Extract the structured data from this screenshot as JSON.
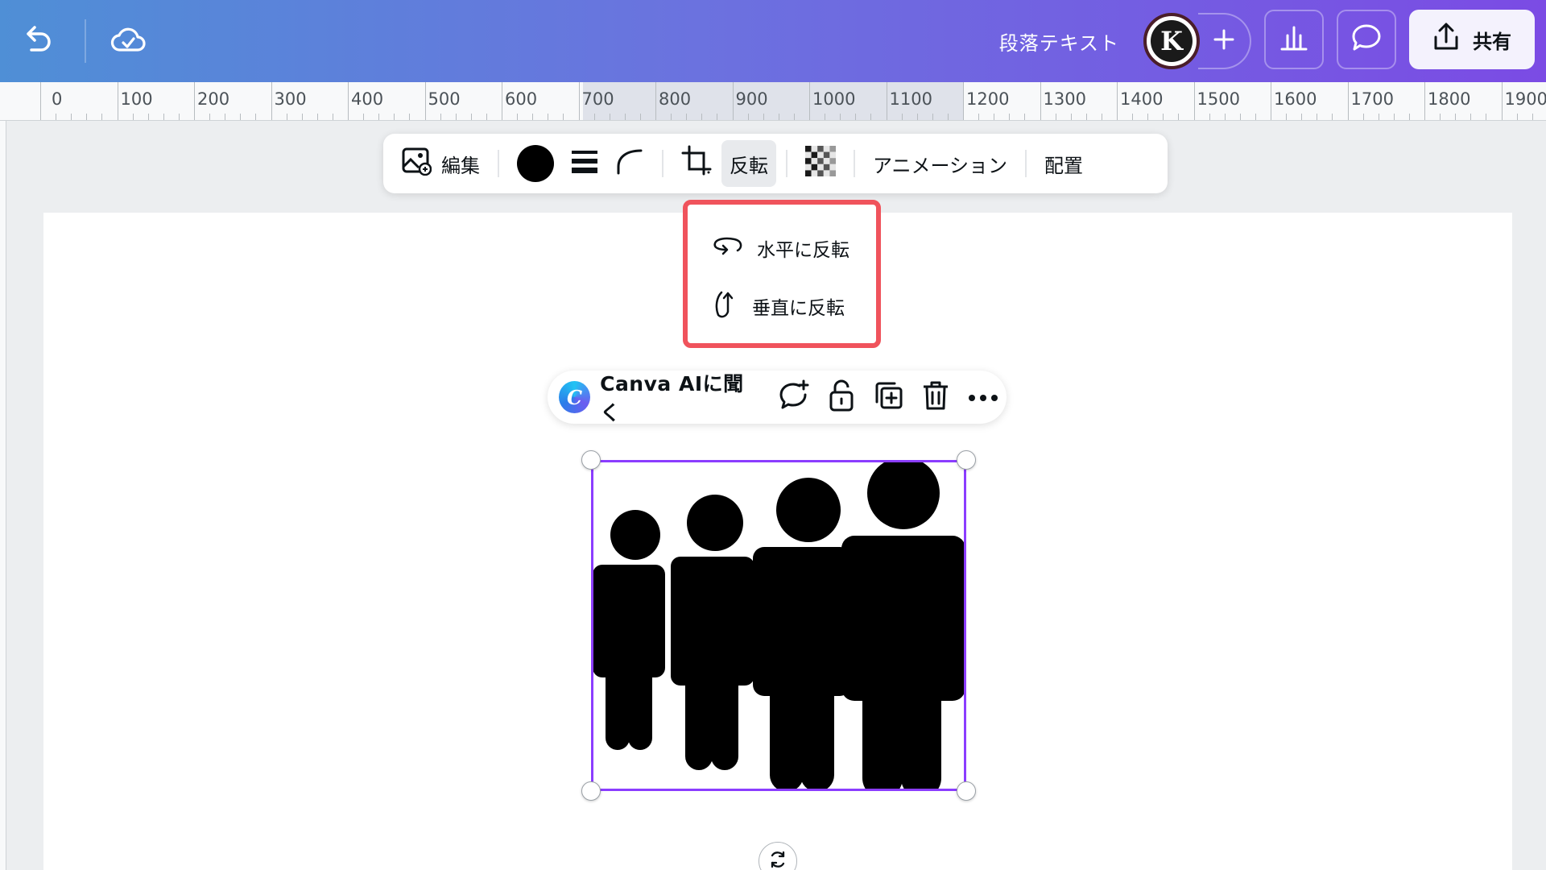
{
  "header": {
    "doc_title": "段落テキスト",
    "avatar_letter": "K",
    "share_label": "共有",
    "gradient": [
      "#4f8fd6",
      "#7b4be4"
    ]
  },
  "ruler": {
    "labels": [
      "0",
      "100",
      "200",
      "300",
      "400",
      "500",
      "600",
      "700",
      "800",
      "900",
      "1000",
      "1100",
      "1200",
      "1300",
      "1400",
      "1500",
      "1600",
      "1700",
      "1800",
      "1900"
    ]
  },
  "toolbar": {
    "edit_label": "編集",
    "color": "#000000",
    "flip_label": "反転",
    "animation_label": "アニメーション",
    "position_label": "配置"
  },
  "flip_menu": {
    "horizontal_label": "水平に反転",
    "vertical_label": "垂直に反転",
    "highlight_color": "#f0535c"
  },
  "actionbar": {
    "ai_label": "Canva AIに聞く",
    "ai_logo_letter": "C"
  },
  "selection": {
    "color": "#8b3dff"
  }
}
